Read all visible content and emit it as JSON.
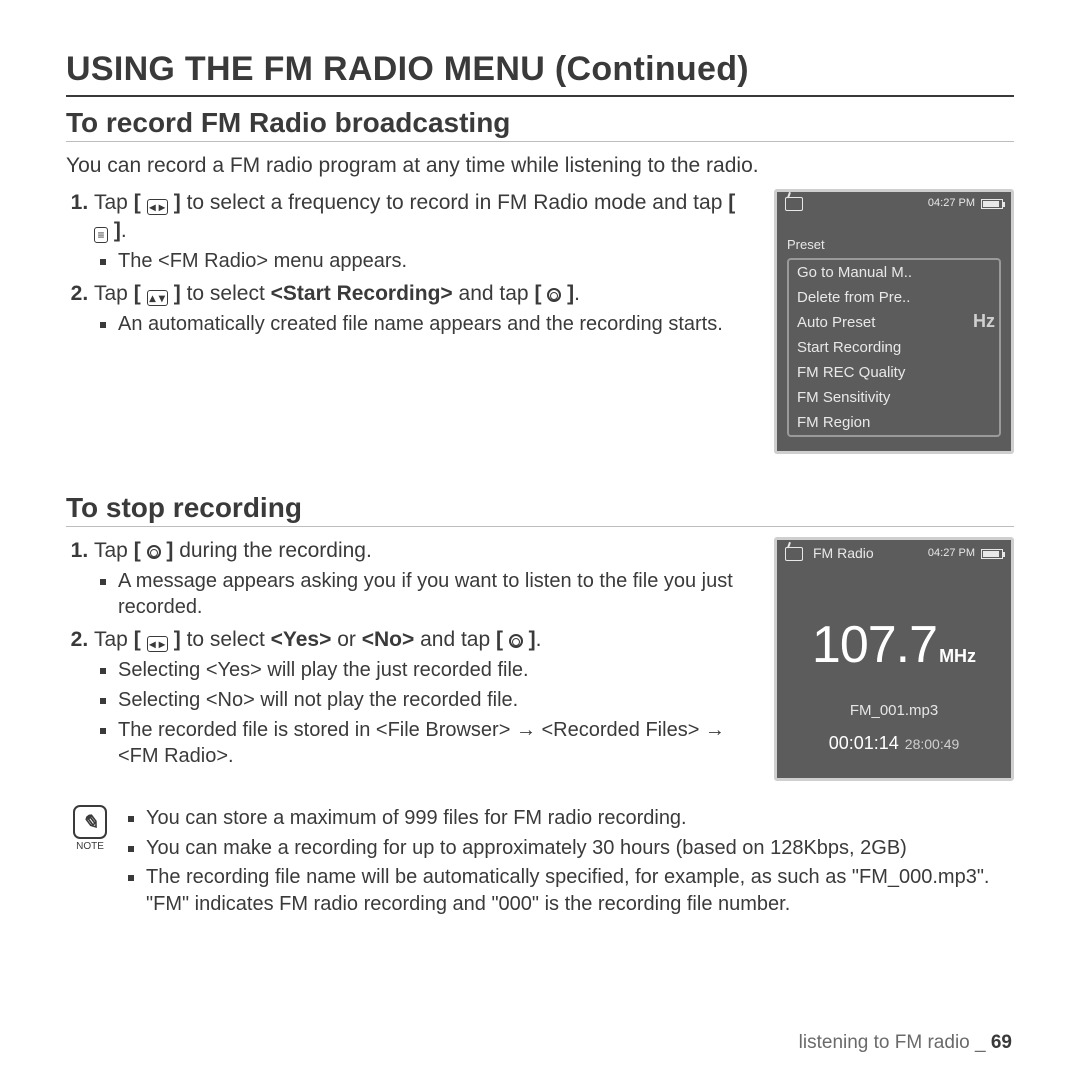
{
  "page_title": "USING THE FM RADIO MENU (Continued)",
  "section1": {
    "heading": "To record FM Radio broadcasting",
    "intro": "You can record a FM radio program at any time while listening to the radio.",
    "step1_a": "Tap ",
    "step1_b": " to select a frequency to record in FM Radio mode and tap ",
    "step1_sub1": "The <FM Radio> menu appears.",
    "step2_a": "Tap ",
    "step2_b": " to select ",
    "step2_strong": "<Start Recording>",
    "step2_c": " and tap ",
    "step2_sub1": "An automatically created file name appears and the recording starts."
  },
  "device1": {
    "time": "04:27 PM",
    "preset": "Preset",
    "hz": "Hz",
    "menu": [
      "Go to Manual M..",
      "Delete from Pre..",
      "Auto Preset",
      "Start Recording",
      "FM REC Quality",
      "FM Sensitivity",
      "FM Region"
    ]
  },
  "section2": {
    "heading": "To stop recording",
    "step1_a": "Tap ",
    "step1_b": " during the recording.",
    "step1_sub1": "A message appears asking you if you want to listen to the file you just recorded.",
    "step2_a": "Tap ",
    "step2_b": " to select ",
    "step2_strong1": "<Yes>",
    "step2_or": " or ",
    "step2_strong2": "<No>",
    "step2_c": " and tap ",
    "step2_sub1": "Selecting <Yes> will play the just recorded file.",
    "step2_sub2": "Selecting <No> will not play the recorded file.",
    "step2_sub3": "The recorded file is stored in <File Browser> → <Recorded Files> → <FM Radio>."
  },
  "device2": {
    "time": "04:27 PM",
    "title": "FM Radio",
    "freq": "107.7",
    "unit": "MHz",
    "filename": "FM_001.mp3",
    "elapsed": "00:01:14",
    "remaining": "28:00:49"
  },
  "note": {
    "label": "NOTE",
    "items": [
      "You can store a maximum of 999 files for FM radio recording.",
      "You can make a recording for up to approximately 30 hours (based on 128Kbps, 2GB)",
      "The recording file name will be automatically specified, for example, as such as \"FM_000.mp3\". \"FM\" indicates FM radio recording and \"000\" is the recording file number."
    ]
  },
  "footer": {
    "text": "listening to FM radio _ ",
    "page": "69"
  },
  "glyphs": {
    "lr": "◂ ▸",
    "ud": "▴ ▾",
    "menu": "≡"
  }
}
